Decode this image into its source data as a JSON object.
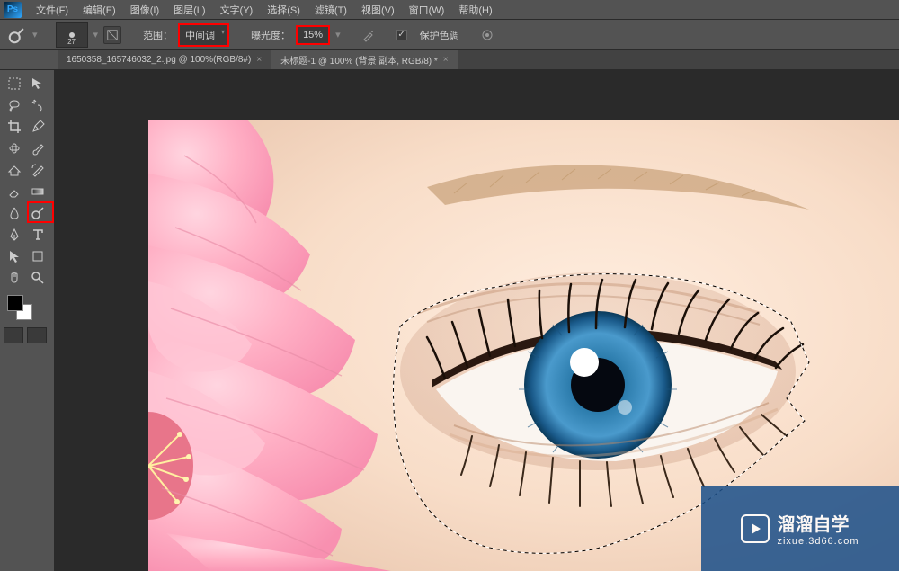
{
  "app": {
    "name": "Ps"
  },
  "menu": {
    "file": "文件(F)",
    "edit": "编辑(E)",
    "image": "图像(I)",
    "layer": "图层(L)",
    "type": "文字(Y)",
    "select": "选择(S)",
    "filter": "滤镜(T)",
    "view": "视图(V)",
    "window": "窗口(W)",
    "help": "帮助(H)"
  },
  "options": {
    "brush_size": "27",
    "range_label": "范围：",
    "range_value": "中间调",
    "exposure_label": "曝光度：",
    "exposure_value": "15%",
    "protect_tones": "保护色调"
  },
  "tabs": {
    "tab1": "1650358_165746032_2.jpg @ 100%(RGB/8#)",
    "tab2": "未标题-1 @ 100% (背景 副本, RGB/8) *"
  },
  "tools": {
    "move": "move-tool",
    "marquee": "marquee-tool",
    "lasso": "lasso-tool",
    "wand": "wand-tool",
    "crop": "crop-tool",
    "eyedropper": "eyedropper-tool",
    "heal": "healing-brush-tool",
    "brush": "brush-tool",
    "stamp": "clone-stamp-tool",
    "history": "history-brush-tool",
    "eraser": "eraser-tool",
    "gradient": "gradient-tool",
    "blur": "blur-tool",
    "dodge": "dodge-tool",
    "pen": "pen-tool",
    "type": "type-tool",
    "path": "path-selection-tool",
    "shape": "shape-tool",
    "hand": "hand-tool",
    "zoom": "zoom-tool"
  },
  "colors": {
    "foreground": "#000000",
    "background": "#ffffff",
    "highlight": "#ff0000",
    "watermark_bg": "#1a4f8a"
  },
  "watermark": {
    "title": "溜溜自学",
    "url": "zixue.3d66.com"
  }
}
